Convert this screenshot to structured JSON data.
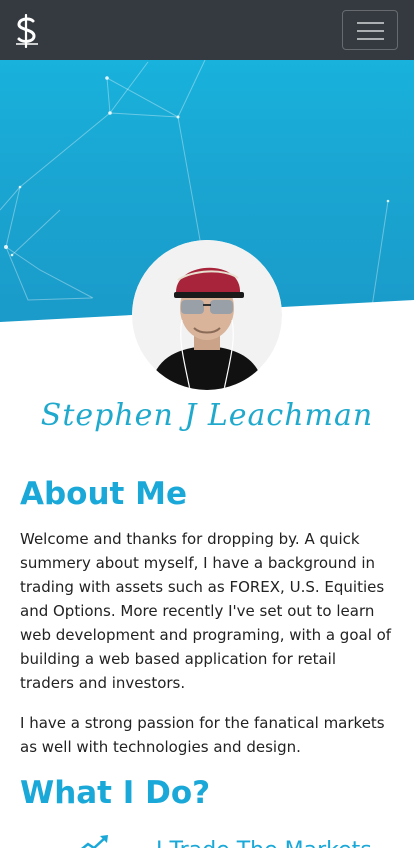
{
  "navbar": {
    "brand_icon": "dollar-s-logo-icon",
    "toggle_icon": "hamburger-menu-icon"
  },
  "hero": {
    "gradient_top": "#18b2dc",
    "gradient_bottom": "#1a9ac9"
  },
  "profile": {
    "name": "Stephen J Leachman",
    "avatar_icon": "profile-photo"
  },
  "about": {
    "title": "About Me",
    "paragraph1": "Welcome and thanks for dropping by. A quick summery about myself, I have a background in trading with assets such as FOREX, U.S. Equities and Options. More recently I've set out to learn web development and programing, with a goal of building a web based application for retail traders and investors.",
    "paragraph2": "I have a strong passion for the fanatical markets as well with technologies and design."
  },
  "what_i_do": {
    "title": "What I Do?",
    "items": [
      {
        "label": "I Trade The Markets",
        "icon": "chart-trend-up-icon"
      }
    ]
  },
  "colors": {
    "navbar": "#343a40",
    "accent": "#19a8d8",
    "text": "#222222"
  }
}
